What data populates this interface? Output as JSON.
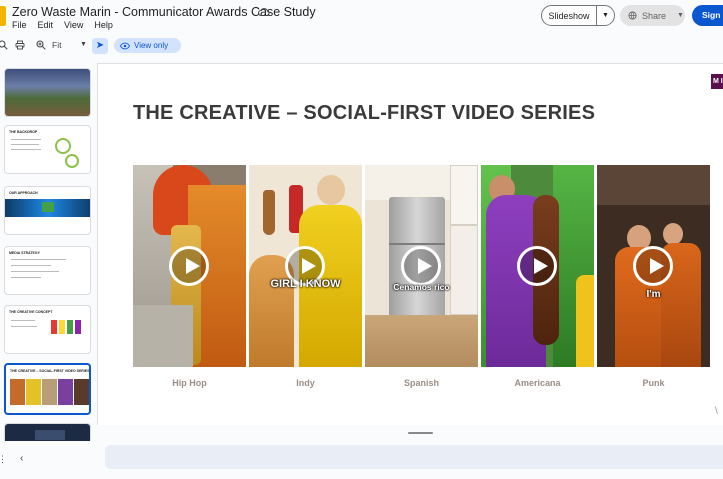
{
  "app": {
    "doc_title": "Zero Waste Marin - Communicator Awards Case Study",
    "menu": [
      "File",
      "Edit",
      "View",
      "Help"
    ],
    "slideshow_label": "Slideshow",
    "share_label": "Share",
    "signin_label": "Sign in",
    "accent_color": "#0b57d0"
  },
  "toolbar": {
    "zoom_value": "Fit",
    "view_mode": "View only"
  },
  "filmstrip": {
    "thumbnails": [
      {
        "title": ""
      },
      {
        "title": "THE BACKDROP"
      },
      {
        "title": "OUR APPROACH"
      },
      {
        "title": "MEDIA STRATEGY"
      },
      {
        "title": "THE CREATIVE CONCEPT"
      },
      {
        "title": "THE CREATIVE – SOCIAL-FIRST VIDEO SERIES"
      },
      {
        "title": ""
      }
    ],
    "active_index": 5
  },
  "slide": {
    "title": "THE CREATIVE – SOCIAL-FIRST VIDEO SERIES",
    "badge": "M I",
    "videos": [
      {
        "caption": "Hip Hop",
        "overlay": ""
      },
      {
        "caption": "Indy",
        "overlay": "GIRL I KNOW"
      },
      {
        "caption": "Spanish",
        "overlay": "Cenamos rico"
      },
      {
        "caption": "Americana",
        "overlay": ""
      },
      {
        "caption": "Punk",
        "overlay": "I'm"
      }
    ]
  }
}
